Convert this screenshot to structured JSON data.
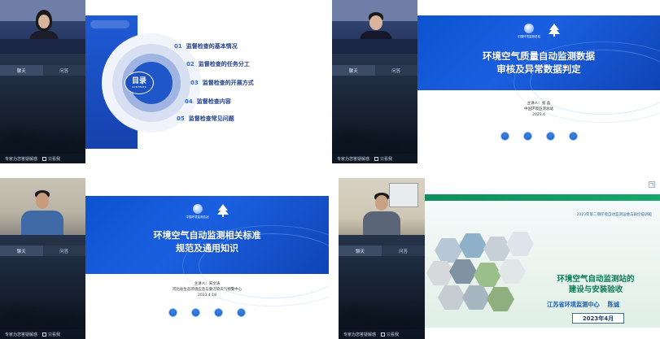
{
  "panels": [
    {
      "tabs": {
        "chat": "聊天",
        "qa": "问答"
      },
      "bottom": {
        "expert": "专家为您答疑解惑",
        "only_me": "只看我"
      },
      "slide": {
        "toc_badge_title": "目录",
        "toc_badge_sub": "CONTENTS",
        "items": [
          {
            "num": "01",
            "label": "监督检查的基本情况"
          },
          {
            "num": "02",
            "label": "监督检查的任务分工"
          },
          {
            "num": "03",
            "label": "监督检查的开展方式"
          },
          {
            "num": "04",
            "label": "监督检查内容"
          },
          {
            "num": "05",
            "label": "监督检查常见问题"
          }
        ]
      }
    },
    {
      "tabs": {
        "chat": "聊天",
        "qa": "问答"
      },
      "bottom": {
        "expert": "专家为您答疑解惑",
        "only_me": "只看我"
      },
      "slide": {
        "org": "中国环境监测总站",
        "title_line1": "环境空气质量自动监测数据",
        "title_line2": "审核及异常数据判定",
        "speaker": "主讲人：张 晶",
        "speaker_org": "中国环境监测总站",
        "date": "2023.4"
      }
    },
    {
      "tabs": {
        "chat": "聊天",
        "qa": "问答"
      },
      "bottom": {
        "expert": "专家为您答疑解惑",
        "only_me": "只看我"
      },
      "slide": {
        "org": "中国环境监测总站",
        "title_line1": "环境空气自动监测相关标准",
        "title_line2": "规范及通用知识",
        "speaker": "主讲人：宋文涛",
        "speaker_org": "河北省生态环境应急与重污染天气预警中心",
        "date": "2023.4.18"
      }
    },
    {
      "tabs": {
        "chat": "聊天",
        "qa": "问答"
      },
      "bottom": {
        "expert": "专家为您答疑解惑",
        "only_me": "只看我"
      },
      "slide": {
        "subtitle": "2023年第二期环境自动监测运维与质控培训班",
        "title_line1": "环境空气自动监测站的",
        "title_line2": "建设与安装验收",
        "org": "江苏省环境监测中心",
        "speaker": "陈诚",
        "date": "2023年4月"
      }
    }
  ],
  "colors": {
    "slide_blue": "#1a5fe0",
    "rail_bg": "#26344b",
    "s4_green": "#0b7d59"
  }
}
